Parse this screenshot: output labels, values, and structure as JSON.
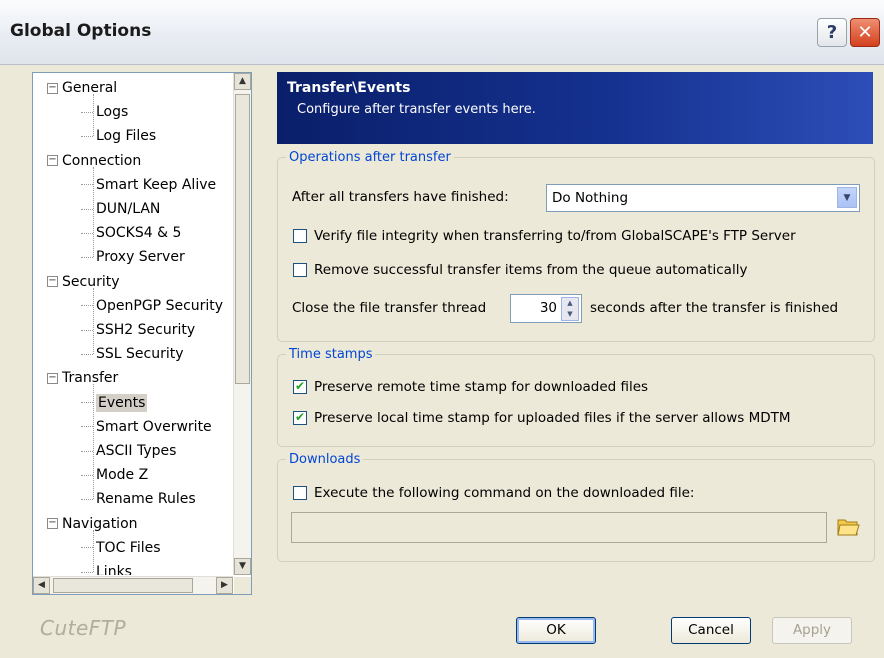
{
  "window": {
    "title": "Global Options",
    "help_glyph": "?",
    "close_glyph": "✕"
  },
  "tree": {
    "items": [
      {
        "label": "General",
        "level": 0
      },
      {
        "label": "Logs",
        "level": 1
      },
      {
        "label": "Log Files",
        "level": 1
      },
      {
        "label": "Connection",
        "level": 0
      },
      {
        "label": "Smart Keep Alive",
        "level": 1
      },
      {
        "label": "DUN/LAN",
        "level": 1
      },
      {
        "label": "SOCKS4 & 5",
        "level": 1
      },
      {
        "label": "Proxy Server",
        "level": 1
      },
      {
        "label": "Security",
        "level": 0
      },
      {
        "label": "OpenPGP Security",
        "level": 1
      },
      {
        "label": "SSH2 Security",
        "level": 1
      },
      {
        "label": "SSL Security",
        "level": 1
      },
      {
        "label": "Transfer",
        "level": 0
      },
      {
        "label": "Events",
        "level": 1,
        "selected": true
      },
      {
        "label": "Smart Overwrite",
        "level": 1
      },
      {
        "label": "ASCII Types",
        "level": 1
      },
      {
        "label": "Mode Z",
        "level": 1
      },
      {
        "label": "Rename Rules",
        "level": 1
      },
      {
        "label": "Navigation",
        "level": 0
      },
      {
        "label": "TOC Files",
        "level": 1
      },
      {
        "label": "Links",
        "level": 1
      }
    ]
  },
  "header": {
    "title": "Transfer\\Events",
    "subtitle": "Configure after transfer events here."
  },
  "ops": {
    "legend": "Operations after transfer",
    "after_all_label": "After all transfers have finished:",
    "after_all_value": "Do Nothing",
    "verify_label": "Verify file integrity when transferring to/from GlobalSCAPE's FTP Server",
    "verify_checked": false,
    "remove_label": "Remove successful transfer items from the queue automatically",
    "remove_checked": false,
    "close_thread_prefix": "Close the file transfer thread",
    "close_thread_value": "30",
    "close_thread_suffix": "seconds after the transfer is finished"
  },
  "timestamps": {
    "legend": "Time stamps",
    "remote_label": "Preserve remote time stamp for downloaded files",
    "remote_checked": true,
    "local_label": "Preserve local time stamp for uploaded files if the server allows MDTM",
    "local_checked": true
  },
  "downloads": {
    "legend": "Downloads",
    "execute_label": "Execute the following command on the downloaded file:",
    "execute_checked": false,
    "command_value": ""
  },
  "buttons": {
    "ok": "OK",
    "cancel": "Cancel",
    "apply": "Apply"
  },
  "brand": "CuteFTP",
  "colors": {
    "accent": "#0046d5",
    "header_bg": "#0a1f6a",
    "check": "#21a121"
  }
}
